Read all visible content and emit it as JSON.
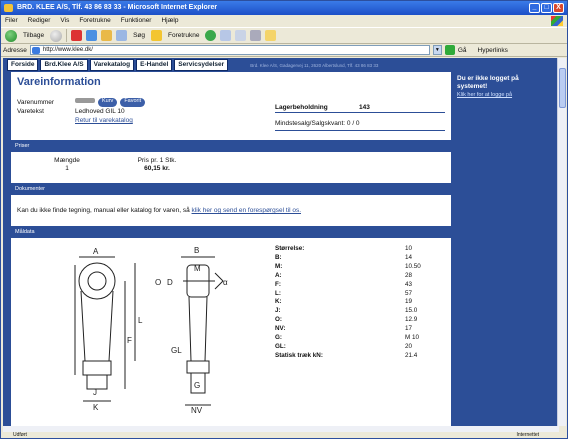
{
  "window": {
    "title": "BRD. KLEE A/S, Tlf. 43 86 83 33 - Microsoft Internet Explorer",
    "controls": [
      "_",
      "□",
      "X"
    ]
  },
  "menu": [
    "Filer",
    "Rediger",
    "Vis",
    "Foretrukne",
    "Funktioner",
    "Hjælp"
  ],
  "toolbar": {
    "back": "Tilbage",
    "search": "Søg",
    "favorites": "Foretrukne"
  },
  "addressbar": {
    "label": "Adresse",
    "value": "http://www.klee.dk/",
    "go": "Gå",
    "links": "Hyperlinks"
  },
  "site": {
    "nav": [
      "Forside",
      "Brd.Klee A/S",
      "Varekatalog",
      "E-Handel",
      "Servicsydelser"
    ],
    "address_line": "Brd. Klee A/S, Gadagervej 11, 2620 Albertslund, Tlf. 43 86 83 33"
  },
  "sidebar": {
    "heading": "Du er ikke logget på systemet!",
    "link": "Klik her for at logge på"
  },
  "product": {
    "page_title": "Vareinformation",
    "varenummer_label": "Varenummer",
    "kurv_button": "Kurv",
    "favorit_button": "Favorit",
    "varetekst_label": "Varetekst",
    "varetekst": "Ledhoved GIL 10",
    "retur_link": "Retur til varekatalog",
    "lager_label": "Lagerbeholdning",
    "lager_value": "143",
    "minsalg_label": "Mindstesalg/Salgskvant: 0 / 0"
  },
  "priser": {
    "section_title": "Priser",
    "col1_header": "Mængde",
    "col1_value": "1",
    "col2_header": "Pris pr. 1 Stk.",
    "col2_value": "60,15 kr."
  },
  "dokumenter": {
    "section_title": "Dokumenter",
    "text": "Kan du ikke finde tegning, manual eller katalog for varen, så",
    "link": "klik her og send en forespørgsel til os."
  },
  "maaldata": {
    "section_title": "Måldata",
    "drawing_labels": [
      "A",
      "B",
      "M",
      "O",
      "D",
      "α",
      "L",
      "F",
      "J",
      "K",
      "GL",
      "G",
      "NV"
    ],
    "rows": [
      {
        "k": "Størrelse:",
        "v": "10"
      },
      {
        "k": "B:",
        "v": "14"
      },
      {
        "k": "M:",
        "v": "10.50"
      },
      {
        "k": "A:",
        "v": "28"
      },
      {
        "k": "F:",
        "v": "43"
      },
      {
        "k": "L:",
        "v": "57"
      },
      {
        "k": "K:",
        "v": "19"
      },
      {
        "k": "J:",
        "v": "15.0"
      },
      {
        "k": "O:",
        "v": "12.9"
      },
      {
        "k": "NV:",
        "v": "17"
      },
      {
        "k": "G:",
        "v": "M 10"
      },
      {
        "k": "GL:",
        "v": "20"
      },
      {
        "k": "Statisk træk kN:",
        "v": "21.4"
      }
    ]
  },
  "status": {
    "left": "Udført",
    "zone": "Internettet"
  }
}
